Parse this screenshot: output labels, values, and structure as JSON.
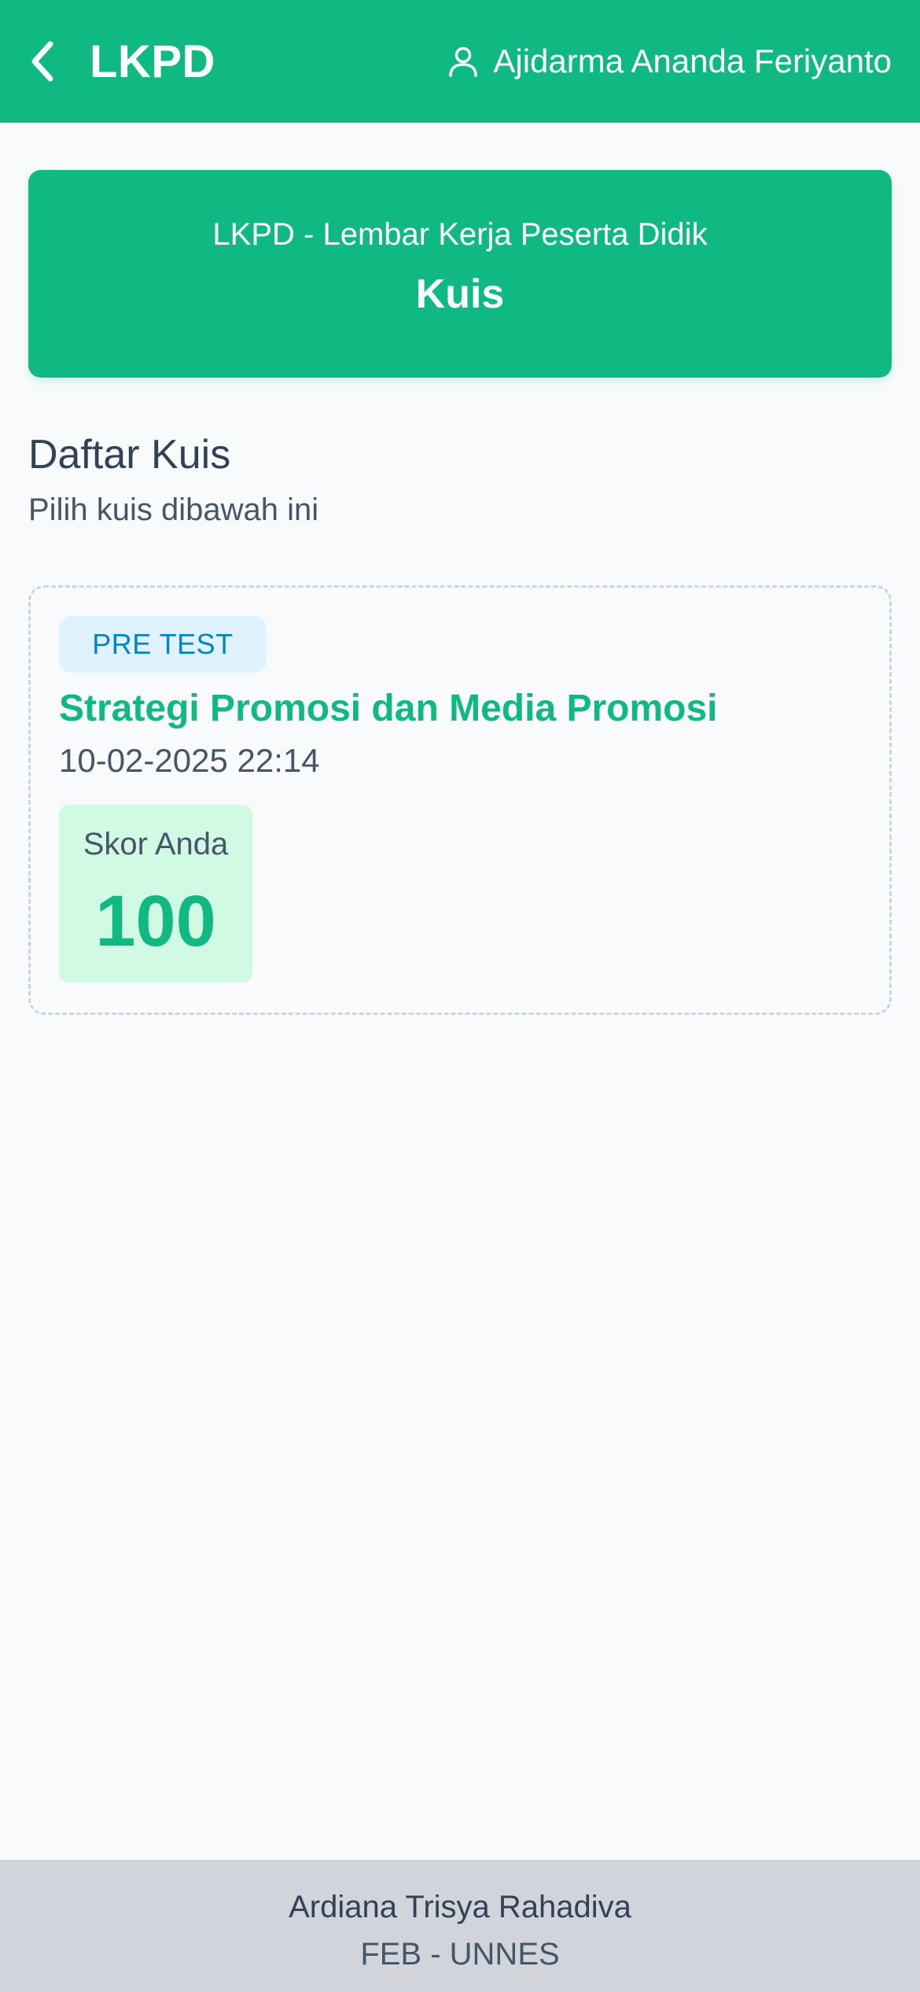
{
  "header": {
    "title": "LKPD",
    "back_icon": "chevron-left-icon",
    "user_icon": "user-icon",
    "user_name": "Ajidarma Ananda Feriyanto"
  },
  "hero": {
    "subtitle": "LKPD - Lembar Kerja Peserta Didik",
    "title": "Kuis"
  },
  "section": {
    "title": "Daftar Kuis",
    "subtitle": "Pilih kuis dibawah ini"
  },
  "quizzes": [
    {
      "badge": "PRE TEST",
      "title": "Strategi Promosi dan Media Promosi",
      "date": "10-02-2025 22:14",
      "score_label": "Skor Anda",
      "score": "100"
    }
  ],
  "footer": {
    "name": "Ardiana Trisya Rahadiva",
    "org": "FEB - UNNES"
  },
  "colors": {
    "primary": "#10b981",
    "badge_bg": "#e0f2fe",
    "badge_text": "#0284c7",
    "score_bg": "#d1fae5",
    "footer_bg": "#d1d5db"
  }
}
